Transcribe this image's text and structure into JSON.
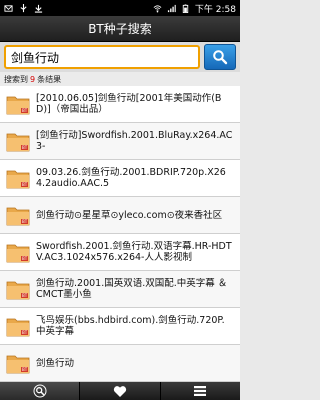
{
  "status": {
    "time": "下午 2:58"
  },
  "app": {
    "title": "BT种子搜索"
  },
  "search": {
    "value": "剑鱼行动"
  },
  "results": {
    "prefix": "搜索到",
    "count": "9",
    "suffix": "条结果"
  },
  "items": [
    "[2010.06.05]剑鱼行动[2001年美国动作(BD)]（帝国出品）",
    "[剑鱼行动]Swordfish.2001.BluRay.x264.AC3-",
    "09.03.26.剑鱼行动.2001.BDRIP.720p.X264.2audio.AAC.5",
    "剑鱼行动⊙星星草⊙yleco.com⊙夜来香社区",
    "Swordfish.2001.剑鱼行动.双语字幕.HR-HDTV.AC3.1024x576.x264-人人影视制",
    "剑鱼行动.2001.国英双语.双国配.中英字幕 ＆ CMCT墨小鱼",
    "飞鸟娱乐(bbs.hdbird.com).剑鱼行动.720P.中英字幕",
    "剑鱼行动"
  ],
  "icons": {
    "folder": "folder-icon",
    "search": "magnifier-icon",
    "favorite": "heart-icon",
    "menu": "list-icon"
  },
  "colors": {
    "accent": "#f0a000",
    "search_button": "#1e7dd0",
    "count": "#d40000"
  }
}
